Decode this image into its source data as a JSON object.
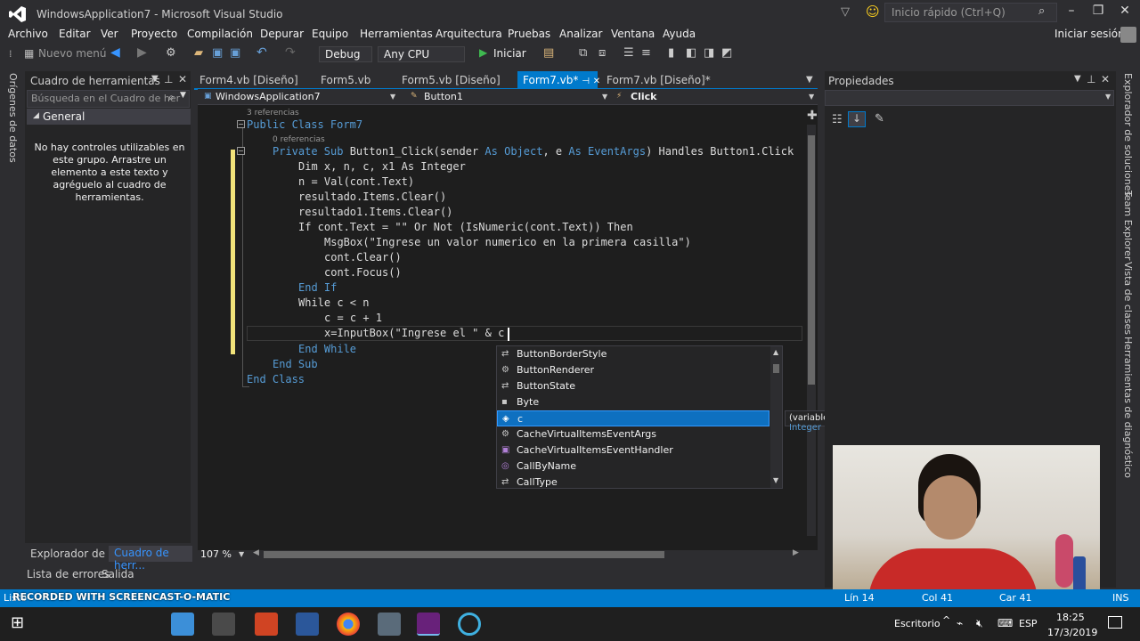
{
  "titlebar": {
    "title": "WindowsApplication7 - Microsoft Visual Studio",
    "quick_launch": "Inicio rápido (Ctrl+Q)"
  },
  "menu": [
    "Archivo",
    "Editar",
    "Ver",
    "Proyecto",
    "Compilación",
    "Depurar",
    "Equipo",
    "Herramientas",
    "Arquitectura",
    "Pruebas",
    "Analizar",
    "Ventana",
    "Ayuda"
  ],
  "signin": "Iniciar sesión",
  "toolbar": {
    "new_menu": "Nuevo menú",
    "config": "Debug",
    "platform": "Any CPU",
    "start": "Iniciar"
  },
  "left_rail": "Orígenes de datos",
  "toolbox": {
    "title": "Cuadro de herramientas",
    "search_placeholder": "Búsqueda en el Cuadro de her",
    "group": "General",
    "empty_msg": "No hay controles utilizables en este grupo. Arrastre un elemento a este texto y agréguelo al cuadro de herramientas."
  },
  "tabs": [
    "Form4.vb [Diseño]",
    "Form5.vb",
    "Form5.vb [Diseño]",
    "Form7.vb*",
    "Form7.vb [Diseño]*"
  ],
  "navbar": {
    "project": "WindowsApplication7",
    "object": "Button1",
    "member": "Click"
  },
  "code": {
    "ref_class": "3 referencias",
    "ref_sub": "0 referencias",
    "line1": "Public Class Form7",
    "line2_a": "Private Sub ",
    "line2_b": "Button1_Click(sender ",
    "line2_c": "As Object",
    ", e ": "",
    "line2_d": ", e ",
    "line2_e": "As EventArgs",
    "line2_f": ") Handles Button1.Click",
    "l3": "Dim x, n, c, x1 As Integer",
    "l4": "n = Val(cont.Text)",
    "l5": "resultado.Items.Clear()",
    "l6": "resultado1.Items.Clear()",
    "l7": "If cont.Text = \"\" Or Not (IsNumeric(cont.Text)) Then",
    "l8": "MsgBox(\"Ingrese un valor numerico en la primera casilla\")",
    "l9": "cont.Clear()",
    "l10": "cont.Focus()",
    "l11": "End If",
    "l12": "While c < n",
    "l13": "c = c + 1",
    "l14": "x=InputBox(\"Ingrese el \" & c",
    "l15": "End While",
    "l16": "End Sub",
    "l17": "End Class"
  },
  "intellisense": [
    "ButtonBorderStyle",
    "ButtonRenderer",
    "ButtonState",
    "Byte",
    "c",
    "CacheVirtualItemsEventArgs",
    "CacheVirtualItemsEventHandler",
    "CallByName",
    "CallType"
  ],
  "tooltip": {
    "a": "(variable local) c ",
    "b": "As Integer"
  },
  "zoom": "107 %",
  "bottom_tabs": [
    "Explorador de s...",
    "Cuadro de herr..."
  ],
  "output_tabs": [
    "Lista de errores",
    "Salida"
  ],
  "properties_title": "Propiedades",
  "right_rail": [
    "Explorador de soluciones",
    "Team Explorer",
    "Vista de clases",
    "Herramientas de diagnóstico"
  ],
  "status": {
    "left": "Listo",
    "ln": "Lín 14",
    "col": "Col 41",
    "car": "Car 41",
    "ins": "INS"
  },
  "watermark": "RECORDED WITH SCREENCAST-O-MATIC",
  "taskbar": {
    "desk": "Escritorio",
    "lang": "ESP",
    "time": "18:25",
    "date": "17/3/2019"
  }
}
